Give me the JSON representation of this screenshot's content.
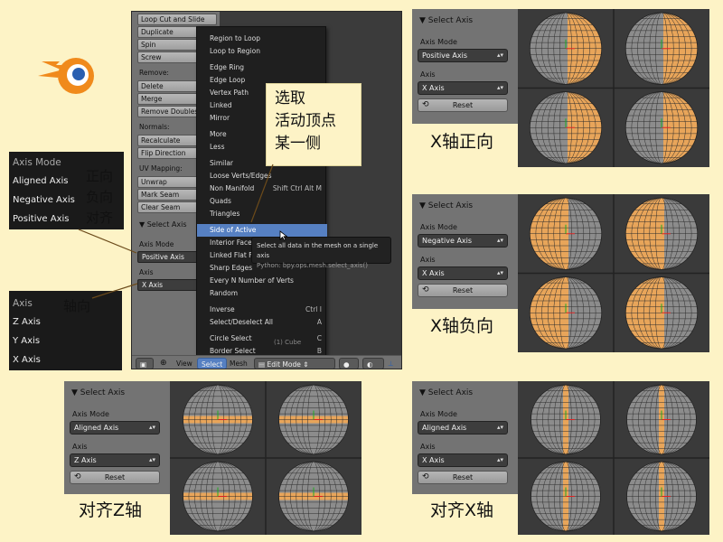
{
  "tool_panel": {
    "buttons_top": [
      "Loop Cut and Slide",
      "Duplicate",
      "Spin",
      "Screw"
    ],
    "remove_header": "Remove:",
    "remove_buttons": [
      "Delete",
      "Merge",
      "Remove Doubles"
    ],
    "normals_header": "Normals:",
    "normals_buttons": [
      "Recalculate",
      "Flip Direction"
    ],
    "uv_header": "UV Mapping:",
    "uv_buttons": [
      "Unwrap",
      "Mark Seam",
      "Clear Seam"
    ],
    "select_axis_header": "Select Axis",
    "axis_mode_label": "Axis Mode",
    "axis_mode_value": "Positive Axis",
    "axis_label": "Axis",
    "axis_value": "X Axis"
  },
  "select_menu": {
    "items": [
      {
        "label": "Region to Loop",
        "shortcut": ""
      },
      {
        "label": "Loop to Region",
        "shortcut": ""
      },
      {
        "label": "Edge Ring",
        "shortcut": ""
      },
      {
        "label": "Edge Loop",
        "shortcut": ""
      },
      {
        "label": "Vertex Path",
        "shortcut": ""
      },
      {
        "label": "Linked",
        "shortcut": ""
      },
      {
        "label": "Mirror",
        "shortcut": ""
      },
      {
        "label": "More",
        "shortcut": ""
      },
      {
        "label": "Less",
        "shortcut": ""
      },
      {
        "label": "Similar",
        "shortcut": ""
      },
      {
        "label": "Loose Verts/Edges",
        "shortcut": ""
      },
      {
        "label": "Non Manifold",
        "shortcut": "Shift Ctrl Alt M"
      },
      {
        "label": "Quads",
        "shortcut": ""
      },
      {
        "label": "Triangles",
        "shortcut": ""
      },
      {
        "label": "Side of Active",
        "shortcut": ""
      },
      {
        "label": "Interior Faces",
        "shortcut": ""
      },
      {
        "label": "Linked Flat Faces",
        "shortcut": ""
      },
      {
        "label": "Sharp Edges",
        "shortcut": ""
      },
      {
        "label": "Every N Number of Verts",
        "shortcut": ""
      },
      {
        "label": "Random",
        "shortcut": ""
      },
      {
        "label": "Inverse",
        "shortcut": "Ctrl I"
      },
      {
        "label": "Select/Deselect All",
        "shortcut": "A"
      },
      {
        "label": "Circle Select",
        "shortcut": "C"
      },
      {
        "label": "Border Select",
        "shortcut": "B"
      }
    ],
    "highlighted": "Side of Active"
  },
  "tooltip": {
    "text": "Select all data in the mesh on a single axis",
    "python": "Python: bpy.ops.mesh.select_axis()"
  },
  "bottom_bar": {
    "view": "View",
    "select": "Select",
    "mesh": "Mesh",
    "mode": "Edit Mode",
    "object_label": "(1) Cube"
  },
  "callout": {
    "lines": [
      "选取",
      "活动顶点",
      "某一侧"
    ]
  },
  "axis_mode_inset": {
    "title": "Axis Mode",
    "options": [
      "Aligned Axis",
      "Negative Axis",
      "Positive Axis"
    ],
    "cn_labels": [
      "正向",
      "负向",
      "对齐"
    ]
  },
  "axis_inset": {
    "title": "Axis",
    "options": [
      "Z Axis",
      "Y Axis",
      "X Axis"
    ],
    "cn_label": "轴向"
  },
  "panels": [
    {
      "header": "Select Axis",
      "mode_label": "Axis Mode",
      "mode": "Positive Axis",
      "axis_label": "Axis",
      "axis": "X Axis",
      "reset": "Reset",
      "caption": "X轴正向"
    },
    {
      "header": "Select Axis",
      "mode_label": "Axis Mode",
      "mode": "Negative Axis",
      "axis_label": "Axis",
      "axis": "X Axis",
      "reset": "Reset",
      "caption": "X轴负向"
    },
    {
      "header": "Select Axis",
      "mode_label": "Axis Mode",
      "mode": "Aligned Axis",
      "axis_label": "Axis",
      "axis": "Z Axis",
      "reset": "Reset",
      "caption": "对齐Z轴"
    },
    {
      "header": "Select Axis",
      "mode_label": "Axis Mode",
      "mode": "Aligned Axis",
      "axis_label": "Axis",
      "axis": "X Axis",
      "reset": "Reset",
      "caption": "对齐X轴"
    }
  ],
  "colors": {
    "background": "#fdf3c6",
    "selected_face": "#e8a55a",
    "mesh_face": "#8c8c8c",
    "menu_highlight": "#5680c2"
  }
}
